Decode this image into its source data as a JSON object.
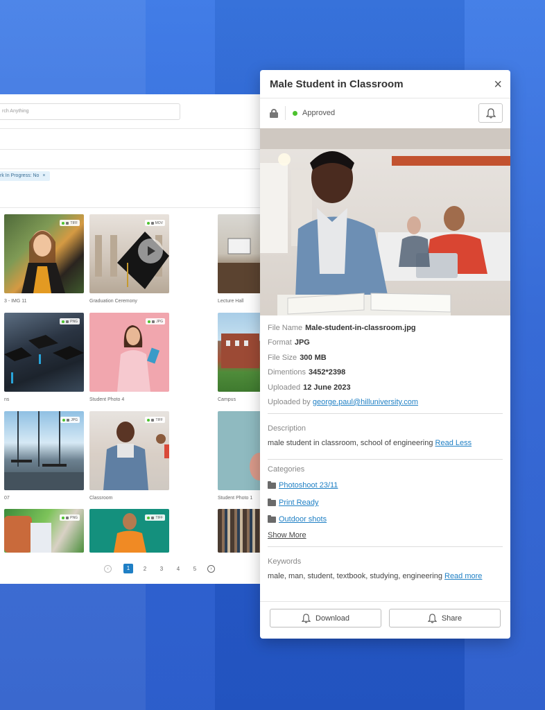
{
  "library": {
    "search_placeholder": "rch Anything",
    "filter_chip": "rk In Progress: No",
    "filter_chip_close": "×",
    "items": [
      {
        "caption": "3 - IMG 11",
        "badge": "TIFF"
      },
      {
        "caption": "Graduation Ceremony",
        "badge": "MOV"
      },
      {
        "caption": "Lecture Hall",
        "badge": ""
      },
      {
        "caption": "ns",
        "badge": "PNG"
      },
      {
        "caption": "Student Photo 4",
        "badge": "JPG"
      },
      {
        "caption": "Campus",
        "badge": ""
      },
      {
        "caption": "07",
        "badge": "JPG"
      },
      {
        "caption": "Classroom",
        "badge": "TIFF"
      },
      {
        "caption": "Student Photo 1",
        "badge": ""
      },
      {
        "caption": "",
        "badge": "PNG"
      },
      {
        "caption": "",
        "badge": "TIFF"
      },
      {
        "caption": "",
        "badge": ""
      }
    ],
    "pagination": {
      "prev": "‹",
      "pages": [
        "1",
        "2",
        "3",
        "4",
        "5"
      ],
      "current": "1",
      "next": "›"
    }
  },
  "modal": {
    "title": "Male Student in Classroom",
    "close": "×",
    "status": "Approved",
    "status_color": "#4cc22e",
    "meta": {
      "file_name_label": "File Name",
      "file_name": "Male-student-in-classroom.jpg",
      "format_label": "Format",
      "format": "JPG",
      "file_size_label": "File Size",
      "file_size": "300 MB",
      "dimensions_label": "Dimentions",
      "dimensions": "3452*2398",
      "uploaded_label": "Uploaded",
      "uploaded": "12 June 2023",
      "uploaded_by_label": "Uploaded by",
      "uploaded_by": "george.paul@hilluniversity.com"
    },
    "description_label": "Description",
    "description": "male student in classroom, school of engineering",
    "read_less": "Read Less",
    "categories_label": "Categories",
    "categories": [
      "Photoshoot 23/11",
      "Print Ready",
      "Outdoor shots"
    ],
    "show_more": "Show More",
    "keywords_label": "Keywords",
    "keywords": "male, man, student, textbook, studying, engineering",
    "read_more": "Read more",
    "download_label": "Download",
    "share_label": "Share"
  },
  "colors": {
    "accent": "#1e7fc4",
    "background": "#2a63d6"
  }
}
